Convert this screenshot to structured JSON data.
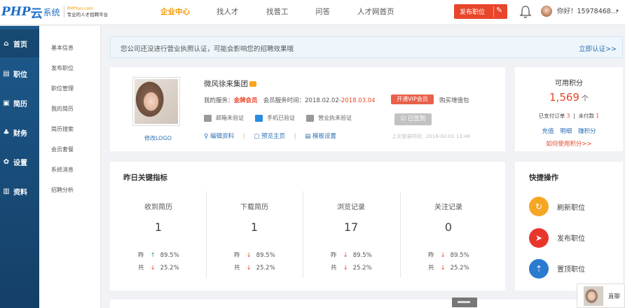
{
  "logo": {
    "php": "PHP",
    "yun": "云",
    "system": "系统",
    "url": "PHPYun.com",
    "tagline": "专业的人才招聘平台"
  },
  "nav": [
    {
      "label": "企业中心",
      "active": true
    },
    {
      "label": "找人才",
      "active": false
    },
    {
      "label": "找普工",
      "active": false
    },
    {
      "label": "问答",
      "active": false
    },
    {
      "label": "人才网首页",
      "active": false
    }
  ],
  "header": {
    "publish_label": "发布职位",
    "greeting": "你好！15978468...",
    "caret": "▾"
  },
  "sidebar": [
    {
      "label": "首页",
      "icon": "home-icon",
      "glyph": "⌂",
      "active": true
    },
    {
      "label": "职位",
      "icon": "briefcase-icon",
      "glyph": "▤",
      "active": false
    },
    {
      "label": "简历",
      "icon": "resume-icon",
      "glyph": "▣",
      "active": false
    },
    {
      "label": "财务",
      "icon": "finance-icon",
      "glyph": "♣",
      "active": false
    },
    {
      "label": "设置",
      "icon": "gear-icon",
      "glyph": "✿",
      "active": false
    },
    {
      "label": "资料",
      "icon": "data-icon",
      "glyph": "▥",
      "active": false
    }
  ],
  "subnav": [
    "基本信息",
    "发布职位",
    "职位管理",
    "我的简历",
    "简历搜索",
    "会员套餐",
    "系统消息",
    "招聘分析"
  ],
  "notice": {
    "text": "您公司还没进行营业执照认证，可能会影响您的招聘效果哦",
    "link": "立即认证>>"
  },
  "profile": {
    "edit_logo": "修改LOGO",
    "company": "微风徐来集团",
    "service_label": "我的服务：",
    "service_level": "金牌会员",
    "period_label": "会员服务时间：2018.02.02-",
    "period_end": "2018.03.04",
    "vip_button": "开通VIP会员",
    "buy_link": "购买增值包",
    "verifications": [
      "邮箱未验证",
      "手机已验证",
      "营业执未验证"
    ],
    "signed_label": "已签到",
    "actions": [
      "编辑资料",
      "预览主页",
      "模板设置"
    ],
    "last_login": "上次登录时间：2018-02-01 13:48"
  },
  "credits": {
    "title": "可用积分",
    "value": "1,569",
    "unit": "个",
    "paid_label": "已支付订单",
    "paid_count": "3",
    "unpaid_label": "未付款",
    "unpaid_count": "1",
    "links": [
      "充值",
      "明细",
      "赚积分"
    ],
    "how": "如何使用积分>>"
  },
  "metrics": {
    "title": "昨日关键指标",
    "yest_label": "昨",
    "total_label": "共",
    "items": [
      {
        "label": "收到简历",
        "value": "1",
        "yesterday": "89.5%",
        "yesterday_dir": "up",
        "total": "25.2%"
      },
      {
        "label": "下载简历",
        "value": "1",
        "yesterday": "89.5%",
        "yesterday_dir": "down",
        "total": "25.2%"
      },
      {
        "label": "浏览记录",
        "value": "17",
        "yesterday": "89.5%",
        "yesterday_dir": "down",
        "total": "25.2%"
      },
      {
        "label": "关注记录",
        "value": "0",
        "yesterday": "89.5%",
        "yesterday_dir": "down",
        "total": "25.2%"
      }
    ]
  },
  "quick": {
    "title": "快捷操作",
    "items": [
      {
        "label": "刷新职位",
        "icon": "refresh-icon",
        "color": "#f5a623",
        "glyph": "↻"
      },
      {
        "label": "发布职位",
        "icon": "send-icon",
        "color": "#e8362a",
        "glyph": "➤"
      },
      {
        "label": "置顶职位",
        "icon": "pin-top-icon",
        "color": "#2a7bd0",
        "glyph": "⇡"
      }
    ]
  },
  "chat": {
    "label": "直聊"
  },
  "colors": {
    "accent": "#f39800",
    "brand": "#1e6fc8",
    "danger": "#e8462a"
  }
}
